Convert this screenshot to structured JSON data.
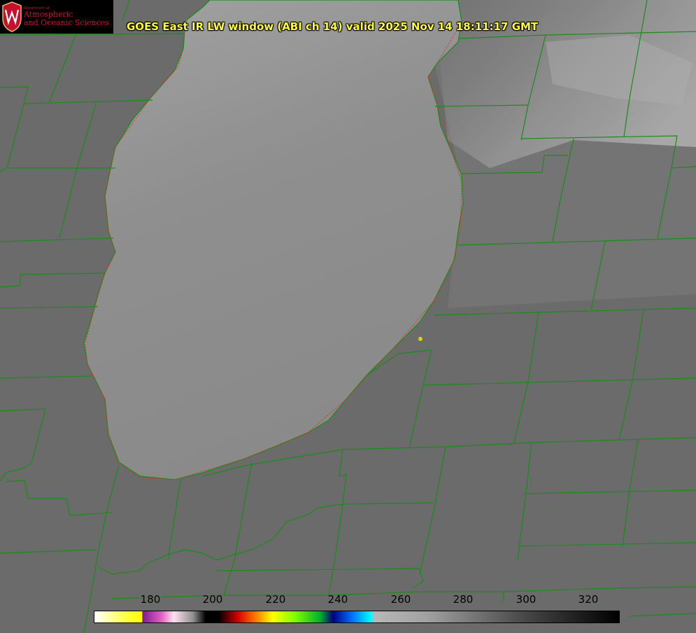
{
  "logo": {
    "department": "Department of",
    "line1": "Atmospheric",
    "line2": "and Oceanic Sciences",
    "icon": "uw-crest-icon"
  },
  "title": "GOES East IR LW window (ABI ch 14) valid 2025 Nov 14 18:11:17 GMT",
  "colorbar": {
    "ticks": [
      "180",
      "200",
      "220",
      "240",
      "260",
      "280",
      "300",
      "320"
    ],
    "range": [
      165,
      330
    ],
    "stops": [
      {
        "t": 165,
        "c": "#ffffff"
      },
      {
        "t": 176,
        "c": "#ffff30"
      },
      {
        "t": 180,
        "c": "#ffff00"
      },
      {
        "t": 180.1,
        "c": "#801a90"
      },
      {
        "t": 186,
        "c": "#e060c0"
      },
      {
        "t": 190,
        "c": "#ffe0f0"
      },
      {
        "t": 196,
        "c": "#909090"
      },
      {
        "t": 200,
        "c": "#000000"
      },
      {
        "t": 204,
        "c": "#000000"
      },
      {
        "t": 210,
        "c": "#d00000"
      },
      {
        "t": 216,
        "c": "#ff8000"
      },
      {
        "t": 221,
        "c": "#ffff00"
      },
      {
        "t": 228,
        "c": "#80ff00"
      },
      {
        "t": 236,
        "c": "#00b030"
      },
      {
        "t": 240,
        "c": "#000080"
      },
      {
        "t": 246,
        "c": "#0070ff"
      },
      {
        "t": 252,
        "c": "#00ffff"
      },
      {
        "t": 253,
        "c": "#b8b8b8"
      },
      {
        "t": 270,
        "c": "#a0a0a0"
      },
      {
        "t": 300,
        "c": "#484848"
      },
      {
        "t": 330,
        "c": "#000000"
      }
    ]
  },
  "colors": {
    "title": "#ffff33",
    "boundary": "#1a8c1a",
    "lake": "#8c8c8c",
    "land": "#6b6b6b",
    "marker": "#e0d000"
  }
}
